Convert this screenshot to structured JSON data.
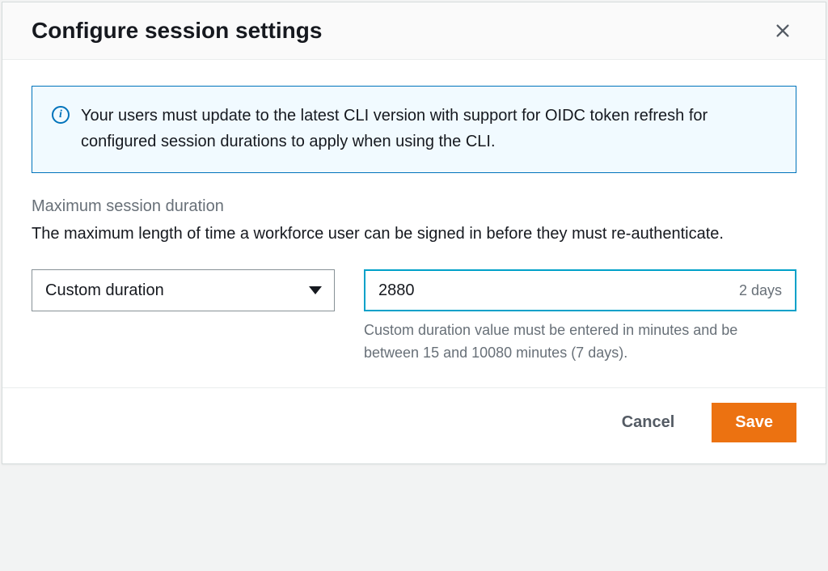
{
  "modal": {
    "title": "Configure session settings",
    "infoBanner": "Your users must update to the latest CLI version with support for OIDC token refresh for configured session durations to apply when using the CLI.",
    "field": {
      "label": "Maximum session duration",
      "description": "The maximum length of time a workforce user can be signed in before they must re-authenticate.",
      "selectValue": "Custom duration",
      "inputValue": "2880",
      "inputSuffix": "2 days",
      "hint": "Custom duration value must be entered in minutes and be between 15 and 10080 minutes (7 days)."
    },
    "buttons": {
      "cancel": "Cancel",
      "save": "Save"
    }
  },
  "colors": {
    "primary": "#ec7211",
    "link": "#0073bb",
    "focus": "#00a1c9"
  }
}
